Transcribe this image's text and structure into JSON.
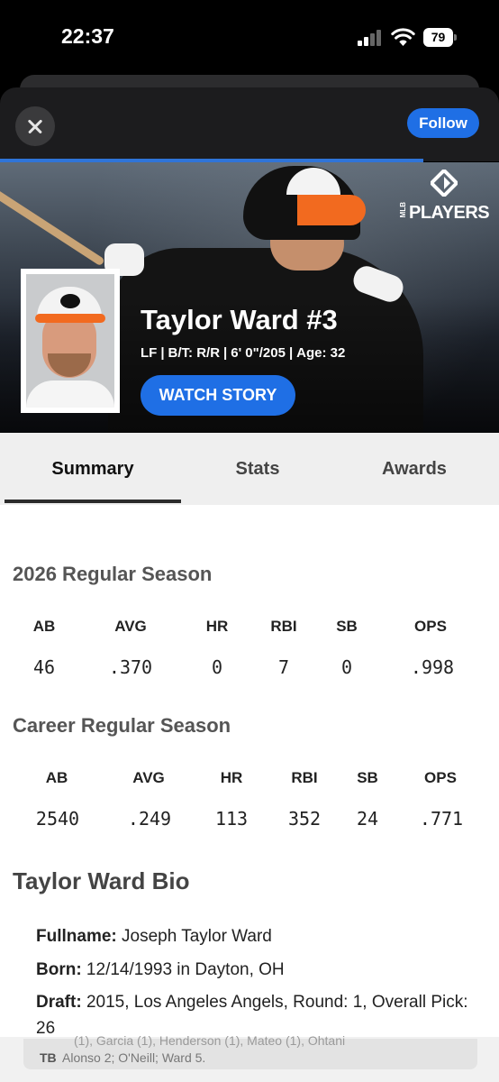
{
  "status_bar": {
    "time": "22:37",
    "battery": "79"
  },
  "modal": {
    "follow_label": "Follow"
  },
  "hero": {
    "logo_small": "MLB",
    "logo_text": "PLAYERS",
    "player_name": "Taylor Ward #3",
    "position": "LF",
    "bats_throws": "B/T: R/R",
    "height_weight": "6' 0\"/205",
    "age": "Age: 32",
    "watch_label": "WATCH STORY"
  },
  "tabs": [
    {
      "label": "Summary",
      "active": true
    },
    {
      "label": "Stats",
      "active": false
    },
    {
      "label": "Awards",
      "active": false
    }
  ],
  "season": {
    "title": "2026 Regular Season",
    "headers": [
      "AB",
      "AVG",
      "HR",
      "RBI",
      "SB",
      "OPS"
    ],
    "values": [
      "46",
      ".370",
      "0",
      "7",
      "0",
      ".998"
    ]
  },
  "career": {
    "title": "Career Regular Season",
    "headers": [
      "AB",
      "AVG",
      "HR",
      "RBI",
      "SB",
      "OPS"
    ],
    "values": [
      "2540",
      ".249",
      "113",
      "352",
      "24",
      ".771"
    ]
  },
  "bio": {
    "title": "Taylor Ward Bio",
    "fullname_label": "Fullname:",
    "fullname_value": " Joseph Taylor Ward",
    "born_label": "Born:",
    "born_value": " 12/14/1993 in Dayton, OH",
    "draft_label": "Draft:",
    "draft_value": " 2015, Los Angeles Angels, Round: 1, Overall Pick: 26"
  },
  "bottom": {
    "ghost": "(1), Garcia (1), Henderson (1), Mateo (1), Ohtani",
    "team": "TB",
    "text": "Alonso 2; O'Neill; Ward 5."
  },
  "colors": {
    "accent": "#1f6fe5",
    "orange": "#f26a1f"
  }
}
